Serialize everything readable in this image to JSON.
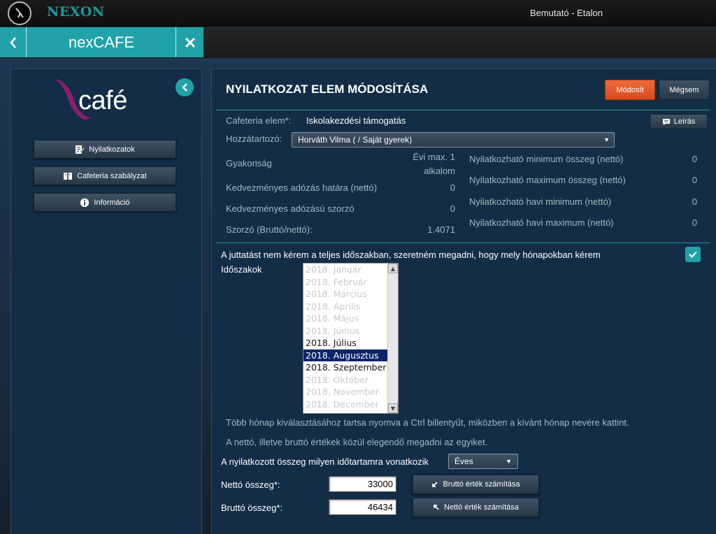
{
  "header": {
    "brand": "NEXON",
    "user": "Bemutató - Etalon"
  },
  "appbar": {
    "app_name": "nexCAFE"
  },
  "sidebar": {
    "logo_word": "café",
    "items": [
      {
        "label": "Nyilatkozatok",
        "icon": "edit-document-icon"
      },
      {
        "label": "Cafeteria szabályzat",
        "icon": "book-icon"
      },
      {
        "label": "Információ",
        "icon": "info-icon"
      }
    ]
  },
  "main": {
    "title": "NYILATKOZAT ELEM MÓDOSÍTÁSA",
    "save_label": "Módosít",
    "cancel_label": "Mégsem",
    "description_label": "Leírás",
    "element_label": "Cafeteria elem*:",
    "element_value": "Iskolakezdési támogatás",
    "dependent_label": "Hozzátartozó:",
    "dependent_value": "Horváth Vilma ( / Saját gyerek)",
    "left_rows": [
      {
        "label": "Gyakoriság",
        "value_line1": "Évi max. 1",
        "value_line2": "alkalom"
      },
      {
        "label": "Kedvezményes adózás határa (nettó)",
        "value": "0"
      },
      {
        "label": "Kedvezményes adózású szorzó",
        "value": "0"
      },
      {
        "label": "Szorzó (Bruttó/nettó):",
        "value": "1.4071"
      }
    ],
    "right_rows": [
      {
        "label": "Nyilatkozható minimum összeg (nettó)",
        "value": "0"
      },
      {
        "label": "Nyilatkozható maximum összeg (nettó)",
        "value": "0"
      },
      {
        "label": "Nyilatkozható havi minimum (nettó)",
        "value": "0"
      },
      {
        "label": "Nyilatkozható havi maximum (nettó)",
        "value": "0"
      }
    ],
    "partial_period_text": "A juttatást nem kérem a teljes időszakban, szeretném megadni, hogy mely hónapokban kérem",
    "partial_period_checked": true,
    "periods_label": "Időszakok",
    "periods": [
      {
        "label": "2018. Január",
        "enabled": false,
        "selected": false
      },
      {
        "label": "2018. Február",
        "enabled": false,
        "selected": false
      },
      {
        "label": "2018. Március",
        "enabled": false,
        "selected": false
      },
      {
        "label": "2018. Április",
        "enabled": false,
        "selected": false
      },
      {
        "label": "2018. Május",
        "enabled": false,
        "selected": false
      },
      {
        "label": "2018. Június",
        "enabled": false,
        "selected": false
      },
      {
        "label": "2018. Július",
        "enabled": true,
        "selected": false
      },
      {
        "label": "2018. Augusztus",
        "enabled": true,
        "selected": true
      },
      {
        "label": "2018. Szeptember",
        "enabled": true,
        "selected": false
      },
      {
        "label": "2018. Október",
        "enabled": false,
        "selected": false
      },
      {
        "label": "2018. November",
        "enabled": false,
        "selected": false
      },
      {
        "label": "2018. December",
        "enabled": false,
        "selected": false
      }
    ],
    "hint1": "Több hónap kiválasztásához tartsa nyomva a Ctrl billentyűt, miközben a kívánt hónap nevére kattint.",
    "hint2": "A nettó, illetve bruttó értékek közül elegendő megadni az egyiket.",
    "period_question": "A nyilatkozott összeg milyen időtartamra vonatkozik",
    "period_value": "Éves",
    "net_label": "Nettó összeg*:",
    "net_value": "33000",
    "gross_label": "Bruttó összeg*:",
    "gross_value": "46434",
    "calc_gross_label": "Bruttó érték számítása",
    "calc_net_label": "Nettó érték számítása"
  },
  "colors": {
    "accent": "#20a2a8",
    "primary_button": "#e2572a",
    "panel": "#132d47"
  }
}
